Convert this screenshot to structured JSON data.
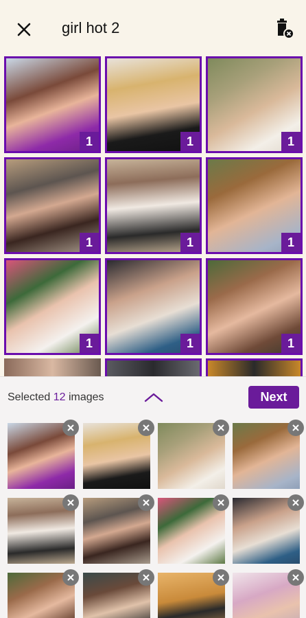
{
  "header": {
    "title": "girl hot 2",
    "close_icon": "close-icon",
    "delete_icon": "trash-x-icon"
  },
  "grid": {
    "badge_value": "1",
    "accent": "#6a1b9a",
    "items": [
      {
        "badge": "1"
      },
      {
        "badge": "1"
      },
      {
        "badge": "1"
      },
      {
        "badge": "1"
      },
      {
        "badge": "1"
      },
      {
        "badge": "1"
      },
      {
        "badge": "1"
      },
      {
        "badge": "1"
      },
      {
        "badge": "1"
      }
    ]
  },
  "selection_panel": {
    "prefix": "Selected ",
    "count": "12",
    "suffix": " images",
    "collapse_icon": "chevron-up-icon",
    "next_label": "Next",
    "remove_icon": "close-circle-icon"
  }
}
